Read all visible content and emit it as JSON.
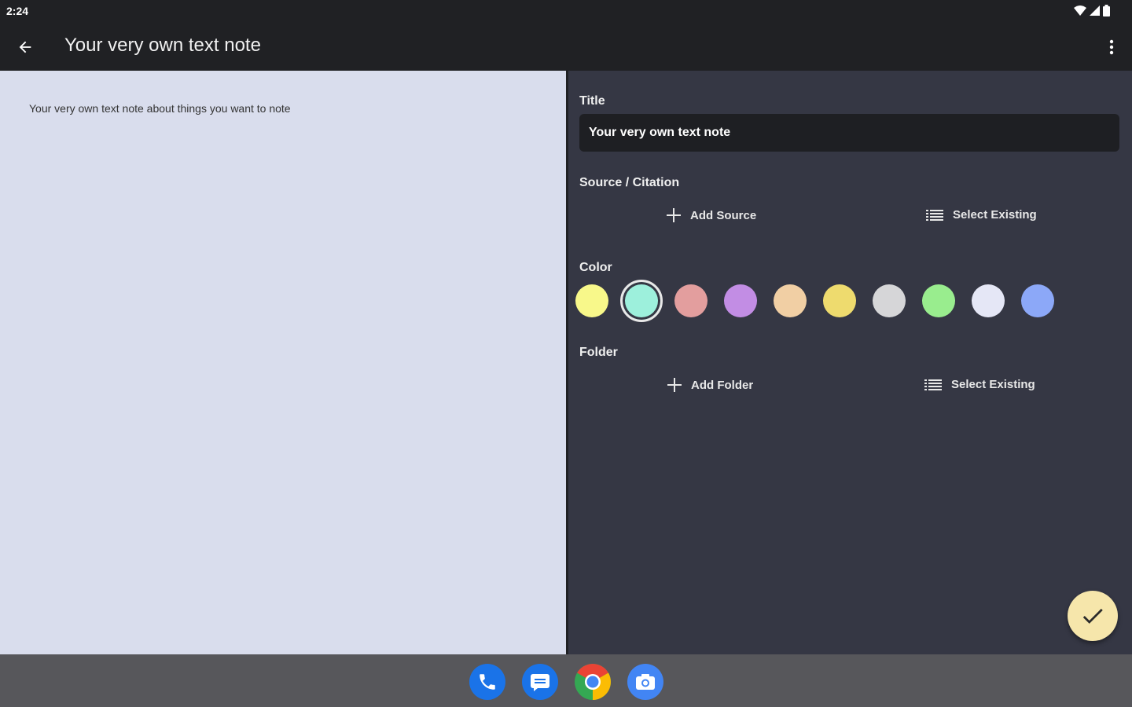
{
  "status_bar": {
    "time": "2:24",
    "icons": [
      "wifi-icon",
      "cellular-signal-icon",
      "battery-icon"
    ]
  },
  "app_bar": {
    "title": "Your very own text note",
    "back_icon": "arrow-back-icon",
    "more_icon": "more-vert-icon"
  },
  "note": {
    "body": "Your very own text note about things you want to note"
  },
  "editor": {
    "title_label": "Title",
    "title_value": "Your very own text note",
    "source_label": "Source / Citation",
    "add_source": "Add Source",
    "select_existing_source": "Select Existing",
    "color_label": "Color",
    "colors": [
      "#f8f88a",
      "#9df0dc",
      "#e39e9e",
      "#c28de4",
      "#f1cfa4",
      "#eedb6e",
      "#d6d6d8",
      "#99ed8e",
      "#e5e7f6",
      "#8ca8f8"
    ],
    "selected_color": "#9df0dc",
    "folder_label": "Folder",
    "add_folder": "Add Folder",
    "select_existing_folder": "Select Existing"
  },
  "fab": {
    "icon": "check-icon",
    "color": "#f6e6ab"
  },
  "dock": {
    "apps": [
      "phone-app-icon",
      "messages-app-icon",
      "chrome-app-icon",
      "camera-app-icon"
    ]
  },
  "theme": {
    "app_bar": "#202124",
    "note_bg": "#d9dded",
    "panel_bg": "#353744",
    "dock_bg": "#57575b"
  }
}
